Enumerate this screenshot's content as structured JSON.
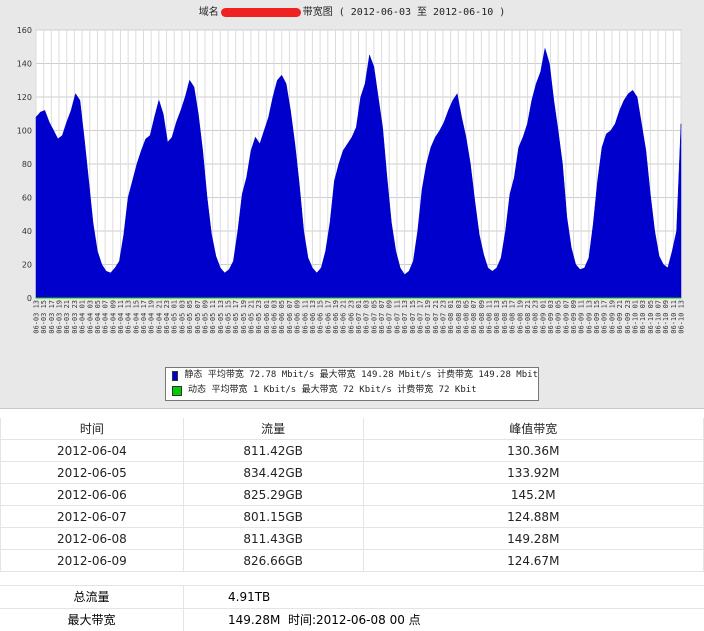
{
  "chart": {
    "title_prefix": "域名",
    "title_suffix": "带宽图 ( 2012-06-03 至 2012-06-10 )"
  },
  "legend": {
    "rows": [
      {
        "color": "#0000cc",
        "name": "静态",
        "text": "平均带宽 72.78 Mbit/s 最大带宽 149.28 Mbit/s 计费带宽 149.28 Mbit"
      },
      {
        "color": "#00cc00",
        "name": "动态",
        "text": "平均带宽 1 Kbit/s 最大带宽 72 Kbit/s 计费带宽 72 Kbit"
      }
    ]
  },
  "table": {
    "headers": [
      "时间",
      "流量",
      "峰值带宽"
    ],
    "rows": [
      [
        "2012-06-04",
        "811.42GB",
        "130.36M"
      ],
      [
        "2012-06-05",
        "834.42GB",
        "133.92M"
      ],
      [
        "2012-06-06",
        "825.29GB",
        "145.2M"
      ],
      [
        "2012-06-07",
        "801.15GB",
        "124.88M"
      ],
      [
        "2012-06-08",
        "811.43GB",
        "149.28M"
      ],
      [
        "2012-06-09",
        "826.66GB",
        "124.67M"
      ]
    ]
  },
  "summary": {
    "total_label": "总流量",
    "total_value": "4.91TB",
    "max_label": "最大带宽",
    "max_value": "149.28M",
    "max_time": "时间:2012-06-08 00 点"
  },
  "chart_data": {
    "type": "area",
    "ylim": [
      0,
      160
    ],
    "yticks": [
      0,
      20,
      40,
      60,
      80,
      100,
      120,
      140,
      160
    ],
    "xticks": [
      "06-03 13",
      "06-03 15",
      "06-03 17",
      "06-03 19",
      "06-03 21",
      "06-03 23",
      "06-04 01",
      "06-04 03",
      "06-04 05",
      "06-04 07",
      "06-04 09",
      "06-04 11",
      "06-04 13",
      "06-04 15",
      "06-04 17",
      "06-04 19",
      "06-04 21",
      "06-04 23",
      "06-05 01",
      "06-05 03",
      "06-05 05",
      "06-05 07",
      "06-05 09",
      "06-05 11",
      "06-05 13",
      "06-05 15",
      "06-05 17",
      "06-05 19",
      "06-05 21",
      "06-05 23",
      "06-06 01",
      "06-06 03",
      "06-06 05",
      "06-06 07",
      "06-06 09",
      "06-06 11",
      "06-06 13",
      "06-06 15",
      "06-06 17",
      "06-06 19",
      "06-06 21",
      "06-06 23",
      "06-07 01",
      "06-07 03",
      "06-07 05",
      "06-07 07",
      "06-07 09",
      "06-07 11",
      "06-07 13",
      "06-07 15",
      "06-07 17",
      "06-07 19",
      "06-07 21",
      "06-07 23",
      "06-08 01",
      "06-08 03",
      "06-08 05",
      "06-08 07",
      "06-08 09",
      "06-08 11",
      "06-08 13",
      "06-08 15",
      "06-08 17",
      "06-08 19",
      "06-08 21",
      "06-08 23",
      "06-09 01",
      "06-09 03",
      "06-09 05",
      "06-09 07",
      "06-09 09",
      "06-09 11",
      "06-09 13",
      "06-09 15",
      "06-09 17",
      "06-09 19",
      "06-09 21",
      "06-09 23",
      "06-10 01",
      "06-10 03",
      "06-10 05",
      "06-10 07",
      "06-10 09",
      "06-10 11",
      "06-10 13"
    ],
    "series": [
      {
        "name": "静态",
        "color": "#0000cc",
        "values": [
          108,
          111,
          112,
          105,
          100,
          95,
          97,
          105,
          112,
          122,
          118,
          95,
          70,
          45,
          28,
          20,
          16,
          15,
          18,
          22,
          38,
          60,
          70,
          80,
          88,
          95,
          97,
          108,
          118,
          110,
          93,
          96,
          105,
          112,
          120,
          130,
          126,
          110,
          88,
          60,
          38,
          25,
          18,
          15,
          17,
          22,
          40,
          62,
          72,
          88,
          96,
          92,
          100,
          108,
          120,
          130,
          133,
          128,
          112,
          92,
          68,
          40,
          24,
          18,
          15,
          18,
          28,
          45,
          70,
          80,
          88,
          92,
          96,
          102,
          120,
          128,
          145,
          138,
          120,
          102,
          72,
          45,
          28,
          18,
          14,
          16,
          22,
          40,
          65,
          80,
          90,
          96,
          100,
          105,
          112,
          118,
          122,
          108,
          96,
          80,
          58,
          38,
          26,
          18,
          16,
          18,
          24,
          40,
          62,
          72,
          90,
          96,
          104,
          118,
          128,
          135,
          149,
          140,
          118,
          100,
          80,
          48,
          30,
          20,
          17,
          18,
          24,
          44,
          70,
          90,
          98,
          100,
          104,
          112,
          118,
          122,
          124,
          120,
          104,
          88,
          62,
          40,
          25,
          20,
          18,
          28,
          40,
          104
        ]
      },
      {
        "name": "动态",
        "color": "#00cc00",
        "values": [
          0
        ]
      }
    ]
  }
}
